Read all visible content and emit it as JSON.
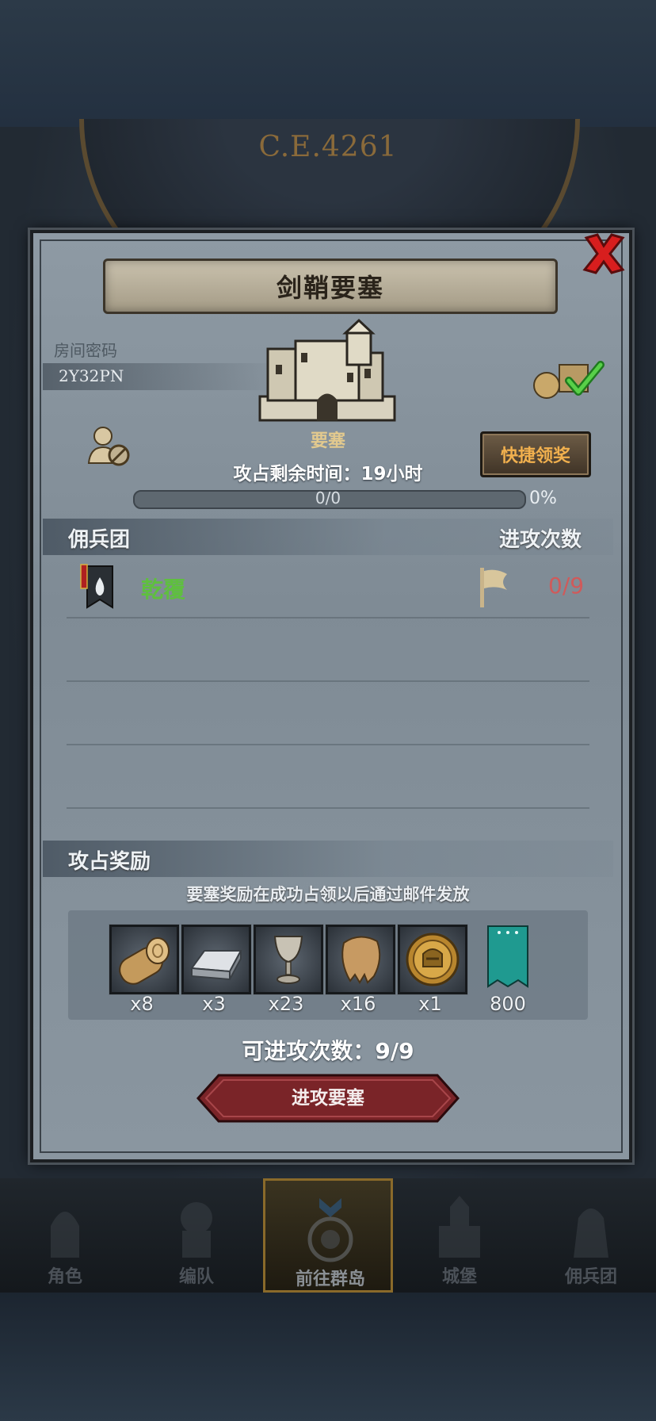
{
  "background": {
    "era_text": "C.E.4261"
  },
  "dialog": {
    "title": "剑鞘要塞",
    "room": {
      "label": "房间密码",
      "code": "2Y32PN"
    },
    "fortress_label": "要塞",
    "quick_claim_label": "快捷领奖",
    "remaining_time": "攻占剩余时间：19小时",
    "progress": {
      "text": "0/0",
      "percent_text": "0%",
      "value": 0
    },
    "mercenary_header": "佣兵团",
    "attack_count_header": "进攻次数",
    "guild_rows": [
      {
        "name": "乾覆",
        "attacks": "0/9"
      }
    ],
    "reward_header": "攻占奖励",
    "reward_note": "要塞奖励在成功占领以后通过邮件发放",
    "rewards": [
      {
        "icon": "wood-log-icon",
        "qty": "x8"
      },
      {
        "icon": "iron-ingot-icon",
        "qty": "x3"
      },
      {
        "icon": "goblet-icon",
        "qty": "x23"
      },
      {
        "icon": "fur-pelt-icon",
        "qty": "x16"
      },
      {
        "icon": "knight-medal-icon",
        "qty": "x1"
      },
      {
        "icon": "guild-banner-icon",
        "qty": "800"
      }
    ],
    "attempts_text": "可进攻次数：9/9",
    "attack_button_label": "进攻要塞"
  },
  "nav": [
    {
      "label": "角色"
    },
    {
      "label": "编队"
    },
    {
      "label": "前往群岛",
      "active": true
    },
    {
      "label": "城堡"
    },
    {
      "label": "佣兵团"
    }
  ],
  "colors": {
    "guild_name": "#5fbf3f",
    "attack_count": "#d05a5a",
    "quick_claim_text": "#f1b04e",
    "close_red": "#e02020"
  }
}
